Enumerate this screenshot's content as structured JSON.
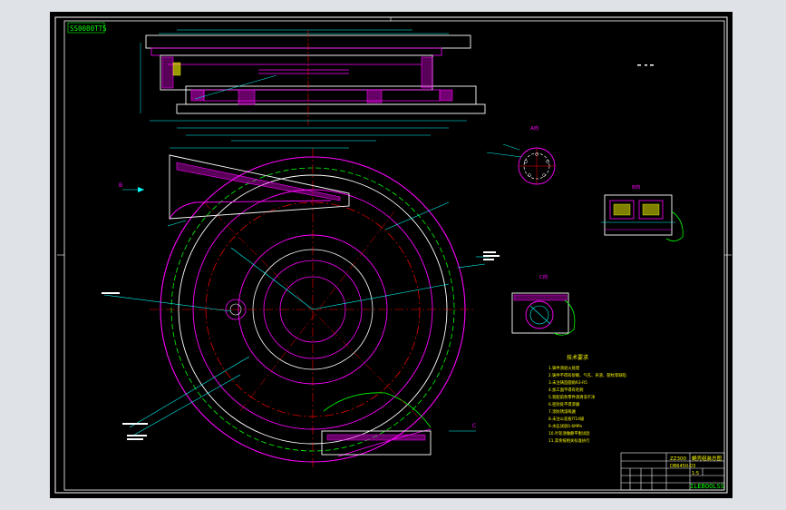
{
  "drawing": {
    "watermark": "SS0080TTS",
    "brand_corner": "ILEBOOLSS",
    "notes_title": "技术要求",
    "notes": [
      "1.铸件须退火处理",
      "2.铸件不得有砂眼、气孔、夹渣、裂纹等缺陷",
      "3.未注铸造圆角R3-R5",
      "4.加工面不得有毛刺",
      "5.装配前各零件须清洗干净",
      "6.密封处不得渗漏",
      "7.涂防锈漆两遍",
      "8.未注公差按IT14级",
      "9.水压试验0.6MPa",
      "10.叶轮须做静平衡试验",
      "11.其余按相关标准执行"
    ],
    "title_block": {
      "code": "ZZ300",
      "name": "蜗壳组装总图",
      "drawing_no": "DB6450-03",
      "scale": "1:5"
    },
    "views": {
      "section_a": "A向",
      "section_b": "B向",
      "section_c": "C向",
      "arrow_b": "B",
      "arrow_c": "C"
    },
    "colors": {
      "paper": "#000000",
      "outline": "#ffffff",
      "magenta": "#ff00ff",
      "cyan": "#00ffff",
      "green": "#00ff00",
      "red": "#ff0000",
      "yellow": "#ffff00"
    }
  }
}
